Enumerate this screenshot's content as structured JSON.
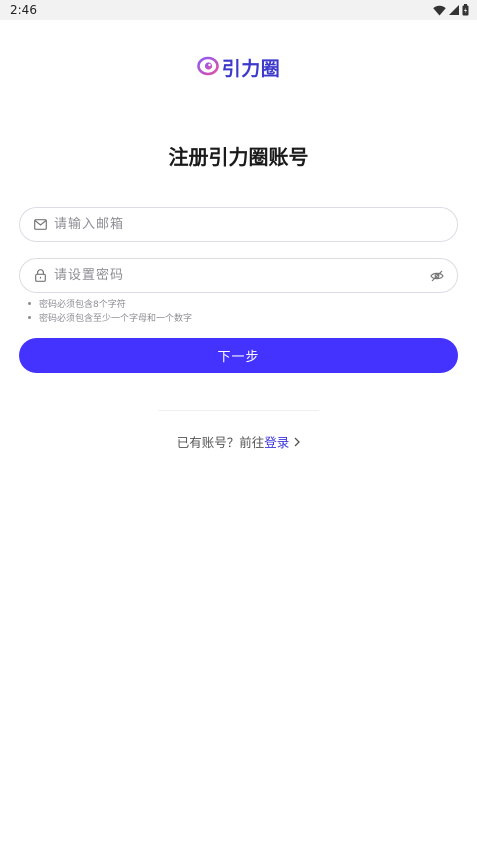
{
  "status_bar": {
    "time": "2:46"
  },
  "app": {
    "logo_text": "引力圈",
    "brand_color": "#3d3acb",
    "accent_color": "#4433ff"
  },
  "page": {
    "title": "注册引力圈账号"
  },
  "form": {
    "email": {
      "placeholder": "请输入邮箱",
      "value": "",
      "icon": "mail-icon"
    },
    "password": {
      "placeholder": "请设置密码",
      "value": "",
      "icon": "lock-icon",
      "toggle_icon": "eye-off-icon"
    },
    "password_rules": [
      "密码必须包含8个字符",
      "密码必须包含至少一个字母和一个数字"
    ],
    "submit_label": "下一步"
  },
  "footer": {
    "prompt": "已有账号？前往",
    "login_label": "登录"
  }
}
